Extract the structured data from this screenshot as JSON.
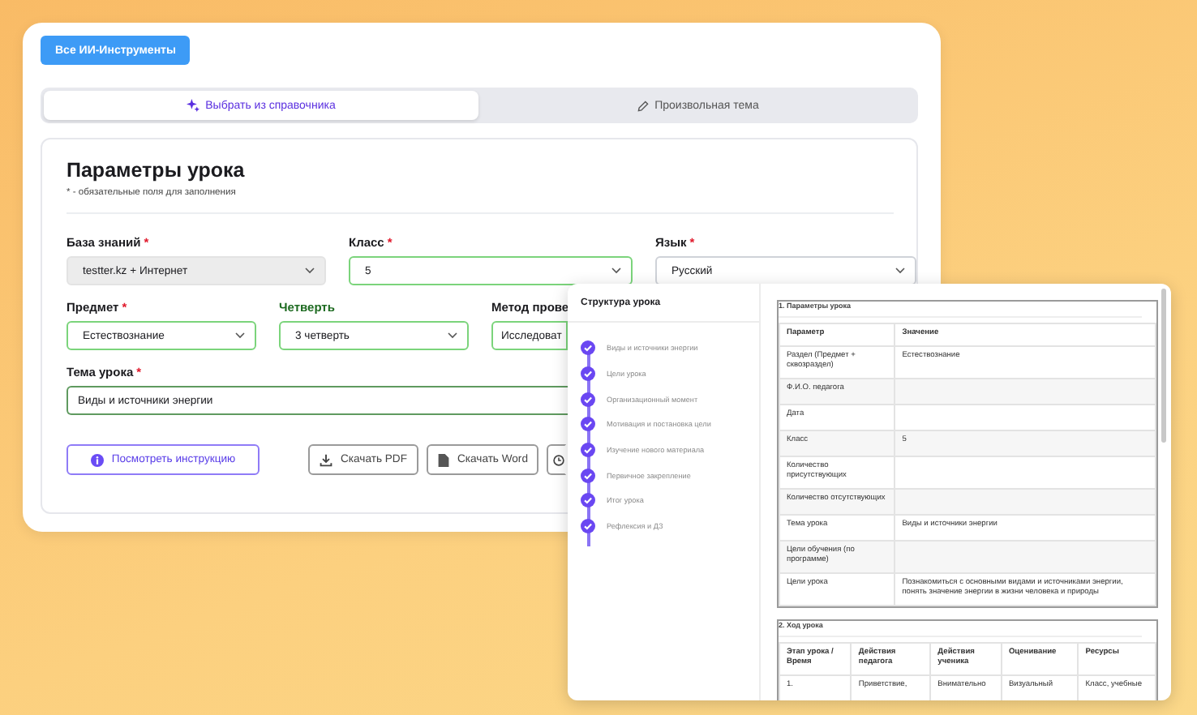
{
  "top_button": "Все ИИ-Инструменты",
  "tabs": [
    {
      "label": "Выбрать из справочника",
      "selected": true
    },
    {
      "label": "Произвольная тема",
      "selected": false
    }
  ],
  "form": {
    "title": "Параметры урока",
    "note": "* - обязательные поля для заполнения",
    "rows": [
      [
        {
          "label": "База знаний",
          "required_mark": "*",
          "kind": "select",
          "value": "testter.kz + Интернет",
          "disabled": true,
          "valid": false,
          "highlighted": false
        },
        {
          "label": "Класс",
          "required_mark": "*",
          "kind": "select",
          "value": "5",
          "disabled": false,
          "valid": true,
          "highlighted": false
        },
        {
          "label": "Язык",
          "required_mark": "*",
          "kind": "select",
          "value": "Русский",
          "disabled": false,
          "valid": false,
          "highlighted": false
        }
      ],
      [
        {
          "label": "Предмет",
          "required_mark": "*",
          "kind": "select",
          "value": "Естествознание",
          "disabled": false,
          "valid": true,
          "highlighted": false
        },
        {
          "label": "Четверть",
          "kind": "select",
          "value": "3 четверть",
          "disabled": false,
          "valid": true,
          "highlighted": true
        },
        {
          "label": "Метод прове",
          "kind": "select",
          "value": "Исследоват",
          "disabled": false,
          "valid": true,
          "highlighted": false
        }
      ],
      [
        {
          "label": "Тема урока",
          "required_mark": "*",
          "kind": "input",
          "value": "Виды и источники энергии",
          "disabled": false,
          "valid": true,
          "highlighted": false
        }
      ]
    ],
    "buttons": [
      {
        "label": "Посмотреть инструкцию",
        "kind": "primary"
      },
      {
        "label": "Скачать PDF",
        "kind": "secondary"
      },
      {
        "label": "Скачать Word",
        "kind": "secondary"
      },
      {
        "kind": "secondary"
      }
    ]
  },
  "structure": {
    "title": "Структура урока",
    "steps": [
      {
        "label": "Виды и источники энергии",
        "done": true
      },
      {
        "label": "Цели урока",
        "done": true
      },
      {
        "label": "Организационный момент",
        "done": true
      },
      {
        "label": "Мотивация и постановка цели",
        "done": true
      },
      {
        "label": "Изучение нового материала",
        "done": true
      },
      {
        "label": "Первичное закрепление",
        "done": true
      },
      {
        "label": "Итог урока",
        "done": true
      },
      {
        "label": "Рефлексия и ДЗ",
        "done": true
      }
    ]
  },
  "document": {
    "sections": [
      {
        "heading": "1. Параметры урока",
        "columns": [
          "Параметр",
          "Значение"
        ],
        "rows": [
          [
            "Раздел (Предмет + сквозраздел)",
            "Естествознание"
          ],
          [
            "Ф.И.О. педагога",
            ""
          ],
          [
            "Дата",
            ""
          ],
          [
            "Класс",
            "5"
          ],
          [
            "Количество присутствующих",
            ""
          ],
          [
            "Количество отсутствующих",
            ""
          ],
          [
            "Тема урока",
            "Виды и источники энергии"
          ],
          [
            "Цели обучения (по программе)",
            ""
          ],
          [
            "Цели урока",
            "Познакомиться с основными видами и источниками энергии, понять значение энергии в жизни человека и природы"
          ]
        ]
      },
      {
        "heading": "2. Ход урока",
        "columns": [
          "Этап урока / Время",
          "Действия педагога",
          "Действия ученика",
          "Оценивание",
          "Ресурсы"
        ],
        "rows": [
          [
            "1.",
            "Приветствие,",
            "Внимательно",
            "Визуальный",
            "Класс, учебные"
          ]
        ]
      }
    ]
  }
}
